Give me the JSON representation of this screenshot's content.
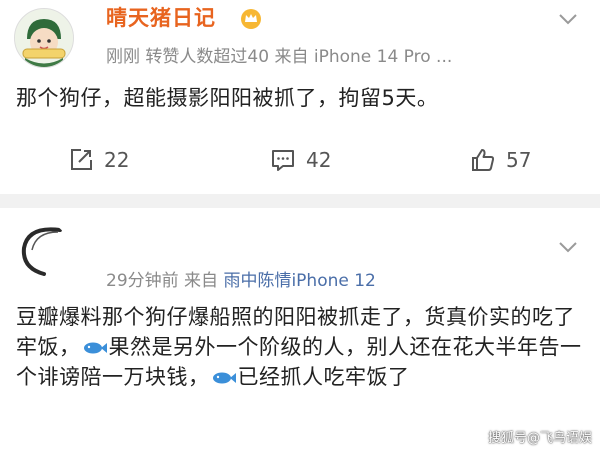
{
  "post1": {
    "username": "晴天猪日记",
    "meta": "刚刚  转赞人数超过40    来自 iPhone 14 Pro ...",
    "content": "那个狗仔，超能摄影阳阳被抓了，拘留5天。",
    "actions": {
      "repost_count": "22",
      "comment_count": "42",
      "like_count": "57"
    }
  },
  "post2": {
    "meta_prefix": "29分钟前    来自 ",
    "device": "雨中陈情iPhone 12",
    "content_a": "豆瓣爆料那个狗仔爆船照的阳阳被抓走了，货真价实的吃了牢饭，",
    "content_b": "果然是另外一个阶级的人，别人还在花大半年告一个诽谤陪一万块钱，",
    "content_c": "已经抓人吃牢饭了"
  },
  "watermark": "搜狐号@飞鸟语娱",
  "colors": {
    "username": "#e8641f",
    "device_link": "#4a6ea8",
    "meta": "#8a8a8a",
    "separator": "#f1f1f1"
  },
  "icons": [
    "avatar",
    "crown-badge-icon",
    "chevron-down-icon",
    "repost-icon",
    "comment-icon",
    "like-icon",
    "fish-emoji-icon"
  ]
}
